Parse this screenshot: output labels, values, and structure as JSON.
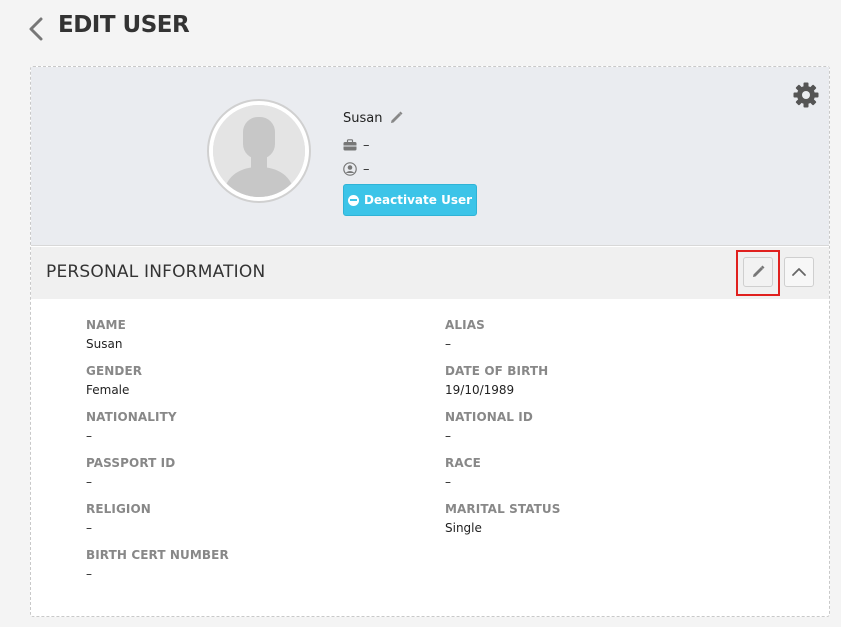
{
  "header": {
    "title": "EDIT USER",
    "back_icon": "chevron-left-icon"
  },
  "profile": {
    "name": "Susan",
    "job_title": "–",
    "role": "–",
    "deactivate_label": "Deactivate User",
    "deactivate_color": "#3cc4e8"
  },
  "section": {
    "title": "PERSONAL INFORMATION"
  },
  "fields": [
    {
      "label": "NAME",
      "value": "Susan"
    },
    {
      "label": "ALIAS",
      "value": "–"
    },
    {
      "label": "GENDER",
      "value": "Female"
    },
    {
      "label": "DATE OF BIRTH",
      "value": "19/10/1989"
    },
    {
      "label": "NATIONALITY",
      "value": "–"
    },
    {
      "label": "NATIONAL ID",
      "value": "–"
    },
    {
      "label": "PASSPORT ID",
      "value": "–"
    },
    {
      "label": "RACE",
      "value": "–"
    },
    {
      "label": "RELIGION",
      "value": "–"
    },
    {
      "label": "MARITAL STATUS",
      "value": "Single"
    },
    {
      "label": "BIRTH CERT NUMBER",
      "value": "–"
    }
  ],
  "colors": {
    "highlight": "#e0201e",
    "profile_bg": "#eaecf0"
  }
}
